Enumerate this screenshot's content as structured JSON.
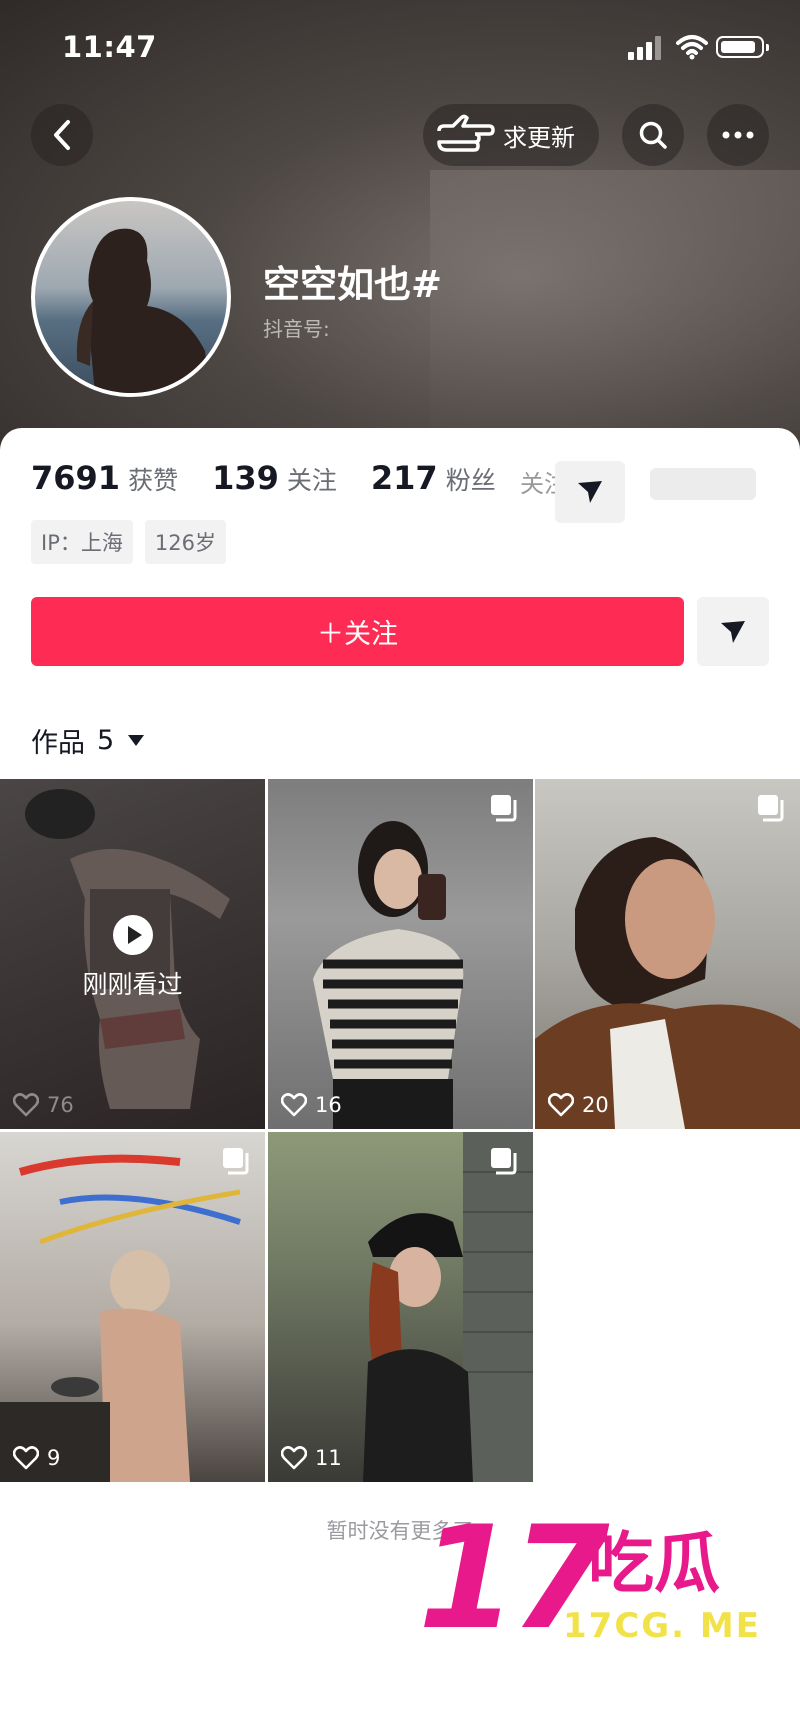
{
  "status": {
    "time": "11:47"
  },
  "header": {
    "update_label": "求更新"
  },
  "profile": {
    "nickname": "空空如也#",
    "douyin_id_label": "抖音号:"
  },
  "stats": [
    {
      "num": "7691",
      "label": "获赞"
    },
    {
      "num": "139",
      "label": "关注"
    },
    {
      "num": "217",
      "label": "粉丝"
    }
  ],
  "ghost": {
    "label": "关注"
  },
  "tags": [
    "IP：上海",
    "126岁"
  ],
  "actions": {
    "follow_label": "＋关注"
  },
  "works": {
    "title": "作品",
    "count": "5"
  },
  "videos": [
    {
      "likes": "76",
      "seen_label": "刚刚看过"
    },
    {
      "likes": "16"
    },
    {
      "likes": "20"
    },
    {
      "likes": "9"
    },
    {
      "likes": "11"
    }
  ],
  "footer": {
    "no_more": "暂时没有更多了"
  },
  "watermark": {
    "number": "17",
    "chars": "吃瓜",
    "url": "17CG. ME"
  },
  "colors": {
    "accent": "#fe2c55",
    "watermark_pink": "#e8198b",
    "watermark_yellow": "#f2e24a"
  },
  "icons": [
    "back-icon",
    "pointing-hand-icon",
    "search-icon",
    "more-icon",
    "send-icon",
    "heart-icon",
    "multi-image-icon",
    "play-icon"
  ]
}
